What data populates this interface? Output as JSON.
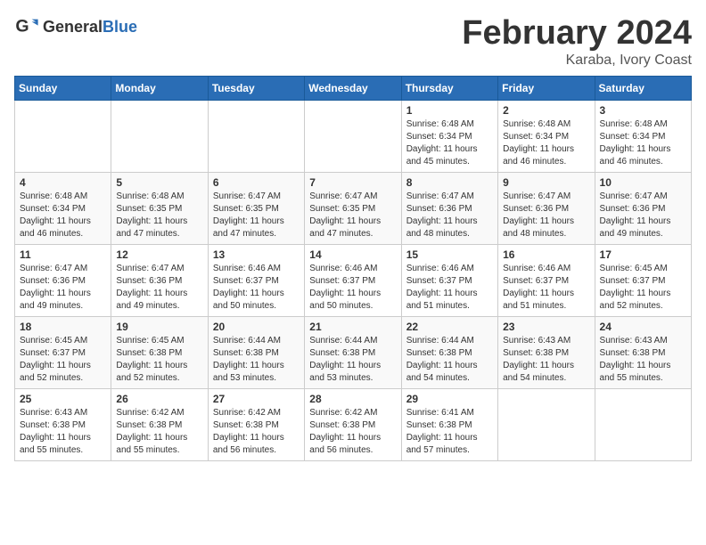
{
  "header": {
    "logo_general": "General",
    "logo_blue": "Blue",
    "month_title": "February 2024",
    "location": "Karaba, Ivory Coast"
  },
  "weekdays": [
    "Sunday",
    "Monday",
    "Tuesday",
    "Wednesday",
    "Thursday",
    "Friday",
    "Saturday"
  ],
  "weeks": [
    [
      {
        "day": "",
        "info": ""
      },
      {
        "day": "",
        "info": ""
      },
      {
        "day": "",
        "info": ""
      },
      {
        "day": "",
        "info": ""
      },
      {
        "day": "1",
        "info": "Sunrise: 6:48 AM\nSunset: 6:34 PM\nDaylight: 11 hours\nand 45 minutes."
      },
      {
        "day": "2",
        "info": "Sunrise: 6:48 AM\nSunset: 6:34 PM\nDaylight: 11 hours\nand 46 minutes."
      },
      {
        "day": "3",
        "info": "Sunrise: 6:48 AM\nSunset: 6:34 PM\nDaylight: 11 hours\nand 46 minutes."
      }
    ],
    [
      {
        "day": "4",
        "info": "Sunrise: 6:48 AM\nSunset: 6:34 PM\nDaylight: 11 hours\nand 46 minutes."
      },
      {
        "day": "5",
        "info": "Sunrise: 6:48 AM\nSunset: 6:35 PM\nDaylight: 11 hours\nand 47 minutes."
      },
      {
        "day": "6",
        "info": "Sunrise: 6:47 AM\nSunset: 6:35 PM\nDaylight: 11 hours\nand 47 minutes."
      },
      {
        "day": "7",
        "info": "Sunrise: 6:47 AM\nSunset: 6:35 PM\nDaylight: 11 hours\nand 47 minutes."
      },
      {
        "day": "8",
        "info": "Sunrise: 6:47 AM\nSunset: 6:36 PM\nDaylight: 11 hours\nand 48 minutes."
      },
      {
        "day": "9",
        "info": "Sunrise: 6:47 AM\nSunset: 6:36 PM\nDaylight: 11 hours\nand 48 minutes."
      },
      {
        "day": "10",
        "info": "Sunrise: 6:47 AM\nSunset: 6:36 PM\nDaylight: 11 hours\nand 49 minutes."
      }
    ],
    [
      {
        "day": "11",
        "info": "Sunrise: 6:47 AM\nSunset: 6:36 PM\nDaylight: 11 hours\nand 49 minutes."
      },
      {
        "day": "12",
        "info": "Sunrise: 6:47 AM\nSunset: 6:36 PM\nDaylight: 11 hours\nand 49 minutes."
      },
      {
        "day": "13",
        "info": "Sunrise: 6:46 AM\nSunset: 6:37 PM\nDaylight: 11 hours\nand 50 minutes."
      },
      {
        "day": "14",
        "info": "Sunrise: 6:46 AM\nSunset: 6:37 PM\nDaylight: 11 hours\nand 50 minutes."
      },
      {
        "day": "15",
        "info": "Sunrise: 6:46 AM\nSunset: 6:37 PM\nDaylight: 11 hours\nand 51 minutes."
      },
      {
        "day": "16",
        "info": "Sunrise: 6:46 AM\nSunset: 6:37 PM\nDaylight: 11 hours\nand 51 minutes."
      },
      {
        "day": "17",
        "info": "Sunrise: 6:45 AM\nSunset: 6:37 PM\nDaylight: 11 hours\nand 52 minutes."
      }
    ],
    [
      {
        "day": "18",
        "info": "Sunrise: 6:45 AM\nSunset: 6:37 PM\nDaylight: 11 hours\nand 52 minutes."
      },
      {
        "day": "19",
        "info": "Sunrise: 6:45 AM\nSunset: 6:38 PM\nDaylight: 11 hours\nand 52 minutes."
      },
      {
        "day": "20",
        "info": "Sunrise: 6:44 AM\nSunset: 6:38 PM\nDaylight: 11 hours\nand 53 minutes."
      },
      {
        "day": "21",
        "info": "Sunrise: 6:44 AM\nSunset: 6:38 PM\nDaylight: 11 hours\nand 53 minutes."
      },
      {
        "day": "22",
        "info": "Sunrise: 6:44 AM\nSunset: 6:38 PM\nDaylight: 11 hours\nand 54 minutes."
      },
      {
        "day": "23",
        "info": "Sunrise: 6:43 AM\nSunset: 6:38 PM\nDaylight: 11 hours\nand 54 minutes."
      },
      {
        "day": "24",
        "info": "Sunrise: 6:43 AM\nSunset: 6:38 PM\nDaylight: 11 hours\nand 55 minutes."
      }
    ],
    [
      {
        "day": "25",
        "info": "Sunrise: 6:43 AM\nSunset: 6:38 PM\nDaylight: 11 hours\nand 55 minutes."
      },
      {
        "day": "26",
        "info": "Sunrise: 6:42 AM\nSunset: 6:38 PM\nDaylight: 11 hours\nand 55 minutes."
      },
      {
        "day": "27",
        "info": "Sunrise: 6:42 AM\nSunset: 6:38 PM\nDaylight: 11 hours\nand 56 minutes."
      },
      {
        "day": "28",
        "info": "Sunrise: 6:42 AM\nSunset: 6:38 PM\nDaylight: 11 hours\nand 56 minutes."
      },
      {
        "day": "29",
        "info": "Sunrise: 6:41 AM\nSunset: 6:38 PM\nDaylight: 11 hours\nand 57 minutes."
      },
      {
        "day": "",
        "info": ""
      },
      {
        "day": "",
        "info": ""
      }
    ]
  ]
}
